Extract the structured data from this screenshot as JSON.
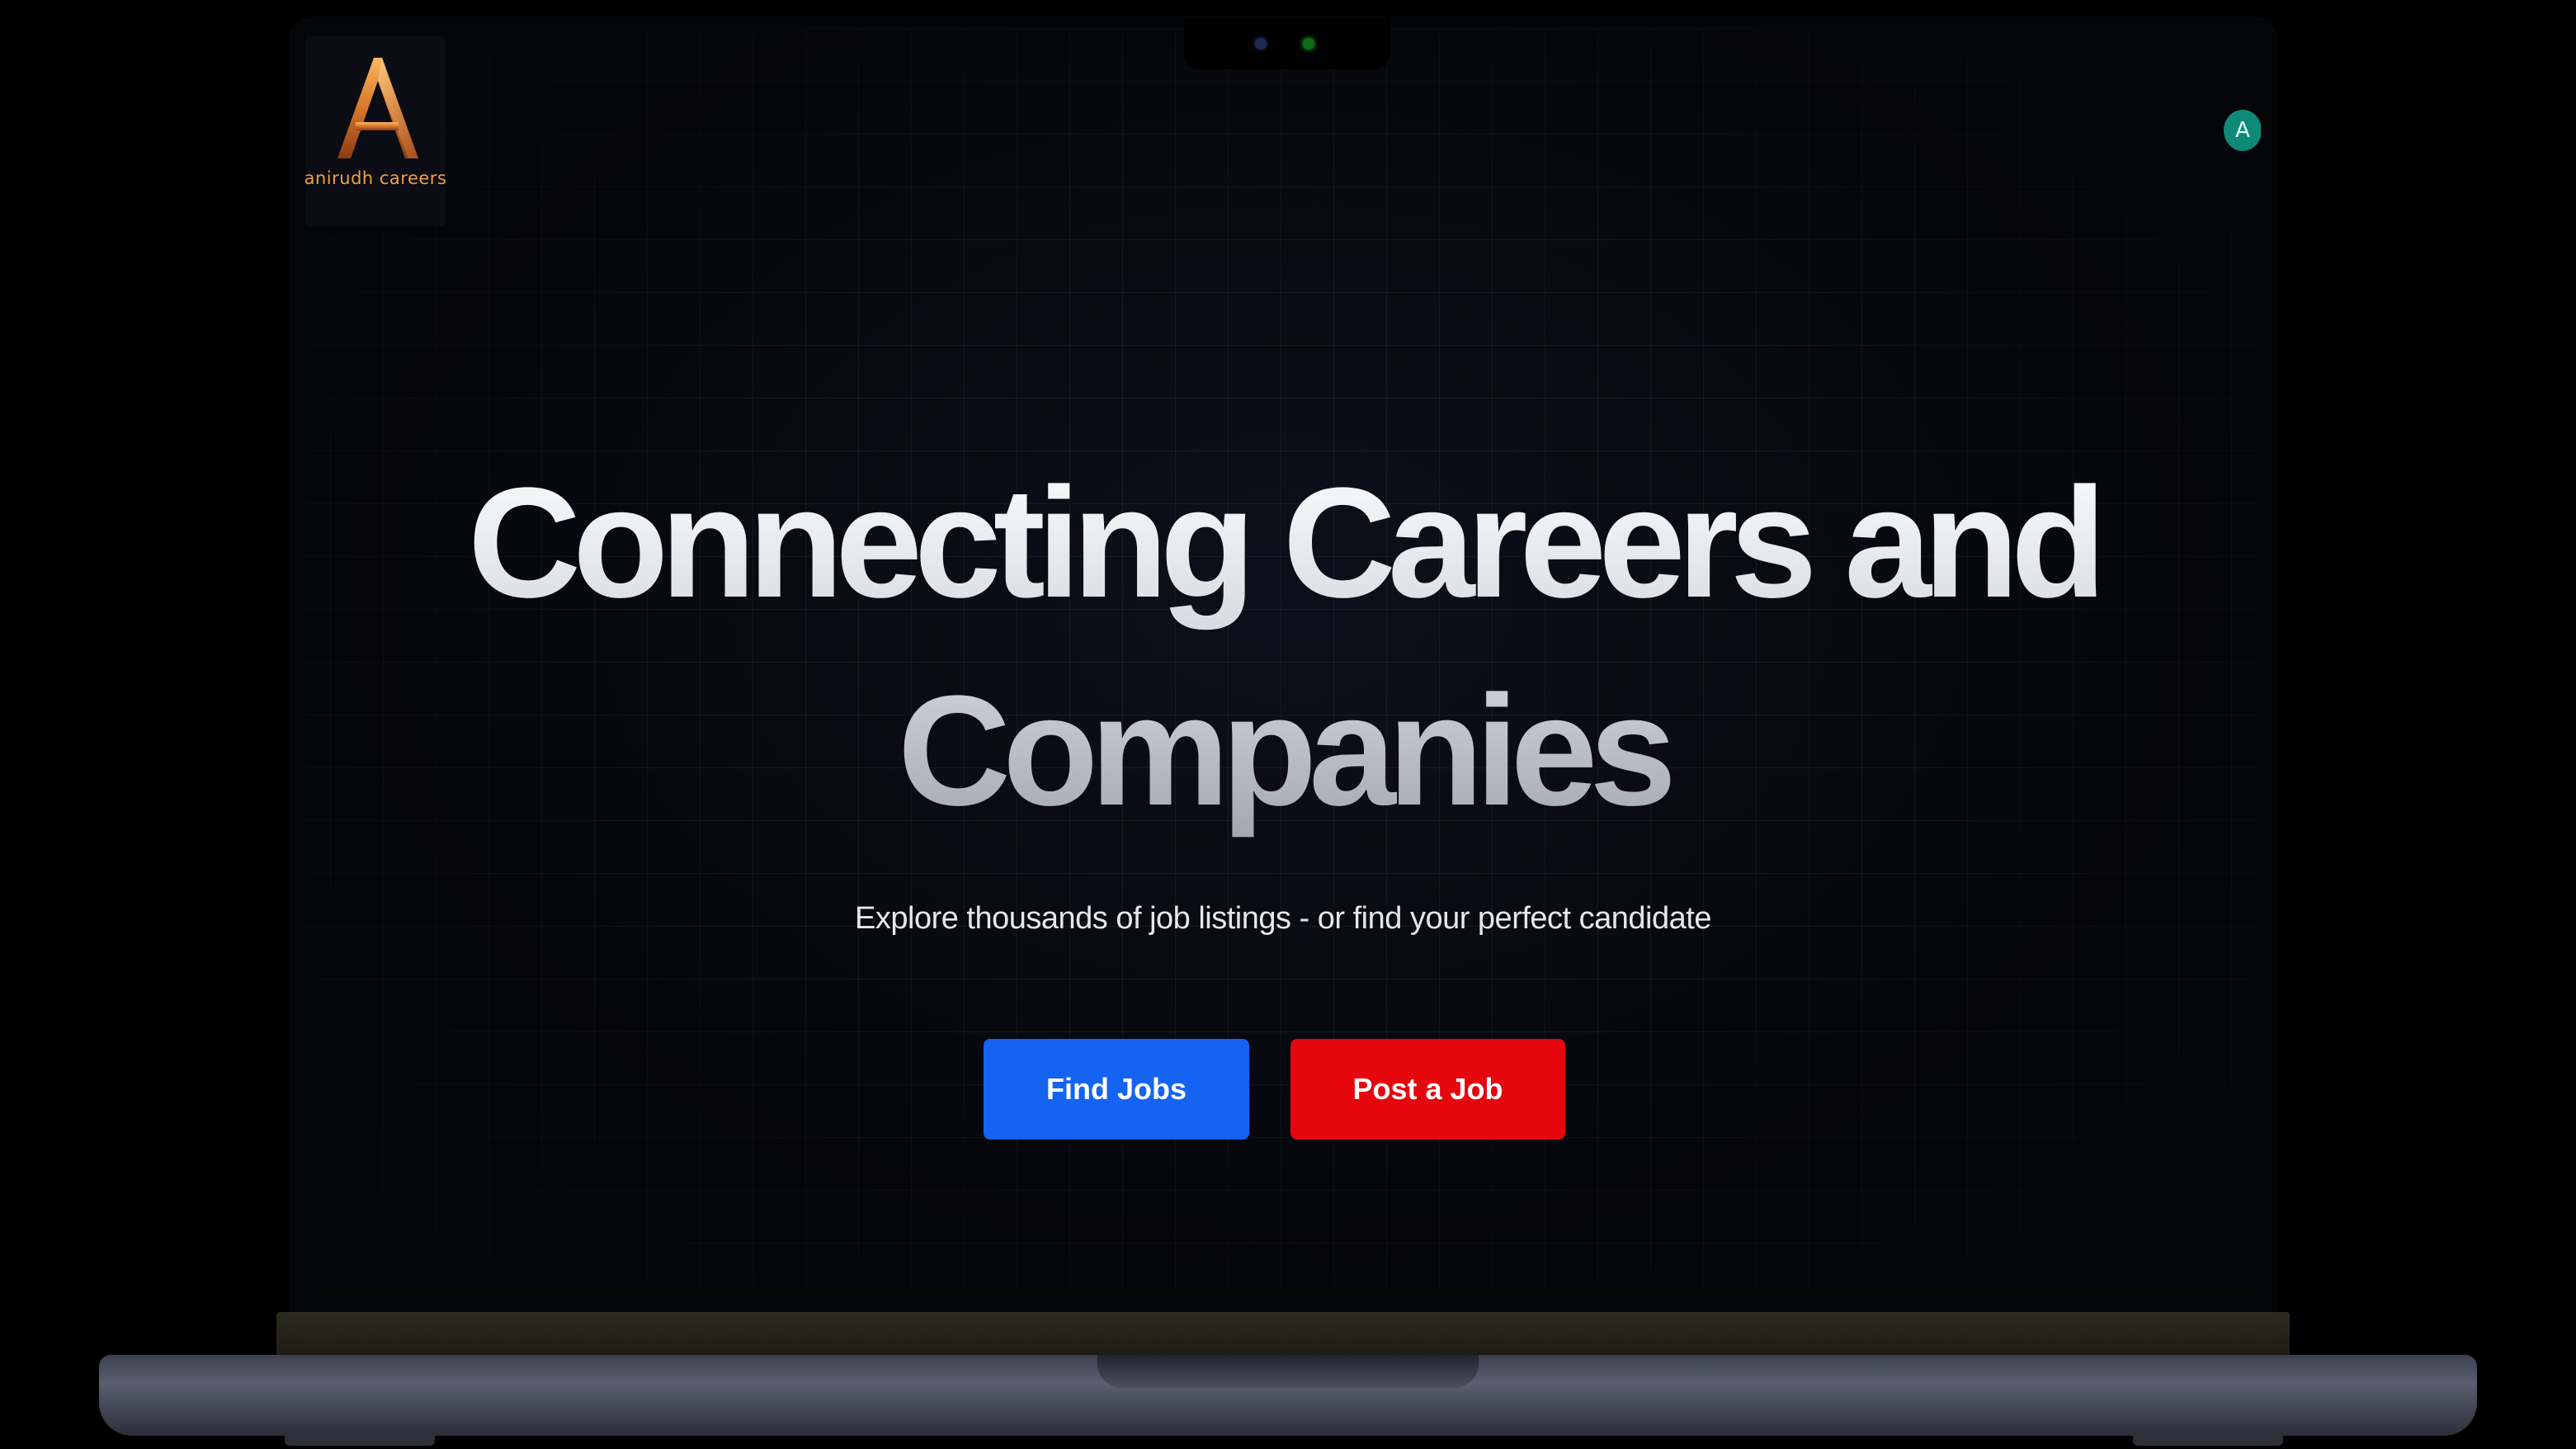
{
  "brand": {
    "logo_letter": "A",
    "logo_text": "anirudh careers"
  },
  "user": {
    "avatar_initial": "A"
  },
  "hero": {
    "title_line1": "Connecting Careers and",
    "title_line2": "Companies",
    "subtitle": "Explore thousands of job listings - or find your perfect candidate"
  },
  "actions": {
    "find_jobs_label": "Find Jobs",
    "post_job_label": "Post a Job"
  },
  "icons": {
    "logo": "letter-a-logo-icon",
    "avatar": "user-avatar-icon"
  },
  "colors": {
    "background": "#05060b",
    "find_jobs_button": "#1463f3",
    "post_job_button": "#e5060e",
    "avatar": "#0f8a78",
    "logo_accent": "#f0a040"
  }
}
